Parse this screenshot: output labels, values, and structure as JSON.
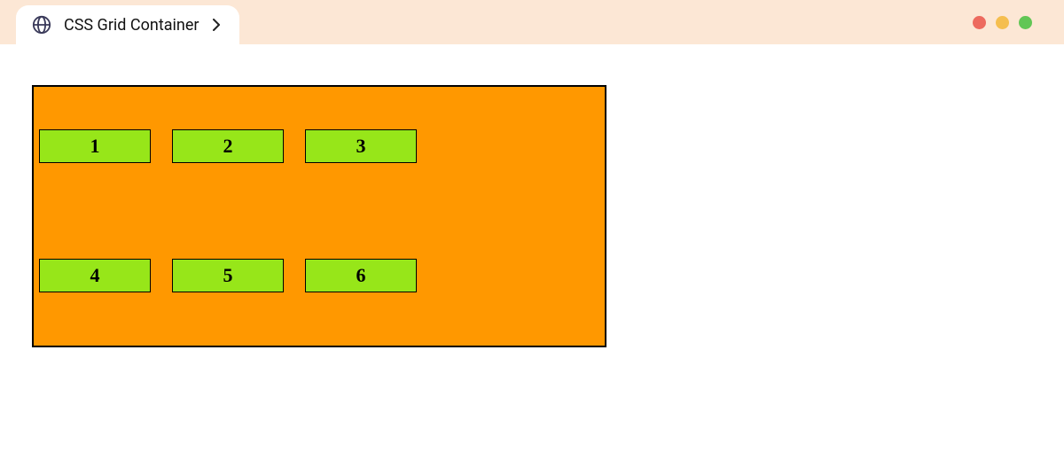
{
  "tab": {
    "title": "CSS Grid Container",
    "icon": "globe-icon"
  },
  "window_controls": {
    "close": "#ed6a5e",
    "minimize": "#f5be4f",
    "maximize": "#62c655"
  },
  "grid": {
    "container_color": "#ff9800",
    "item_color": "#97e619",
    "columns": 3,
    "rows": 2,
    "items": [
      "1",
      "2",
      "3",
      "4",
      "5",
      "6"
    ]
  }
}
